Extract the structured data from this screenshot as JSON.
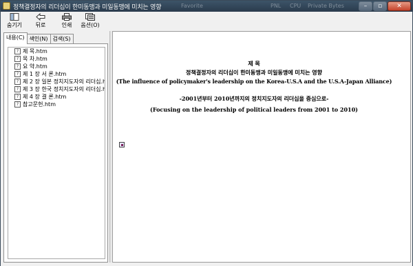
{
  "window": {
    "title": "정책결정자의 리더십이 한미동맹과 미일동맹에 미치는 영향",
    "background_items": [
      "Favorite",
      "PNL",
      "CPU",
      "Private Bytes"
    ]
  },
  "toolbar": {
    "buttons": [
      {
        "label": "숨기기",
        "icon": "hide-icon"
      },
      {
        "label": "뒤로",
        "icon": "back-arrow-icon"
      },
      {
        "label": "인쇄",
        "icon": "printer-icon"
      },
      {
        "label": "옵션(O)",
        "icon": "options-icon"
      }
    ]
  },
  "tabs": [
    "내용(C)",
    "색인(N)",
    "검색(S)"
  ],
  "tree": [
    "제 목.htm",
    "목 차.htm",
    "요 약.htm",
    "제 1 장 서 론.htm",
    "제 2 장 일본 정치지도자의 리더십.h",
    "제 3 장 한국 정치지도자의 리더십.h",
    "제 4 장 결 론.htm",
    "참고문헌.htm"
  ],
  "document": {
    "heading": "제 목",
    "title_ko": "정책결정자의 리더십이 한미동맹과 미일동맹에 미치는 영향",
    "title_en": "(The influence of policymaker's leadership on the Korea-U.S.A and the U.S.A-Japan Alliance)",
    "subtitle_ko": "-2001년부터 2010년까지의 정치지도자의 리더십을 중심으로-",
    "subtitle_en": "(Focusing on the leadership of political leaders from 2001 to 2010)"
  }
}
